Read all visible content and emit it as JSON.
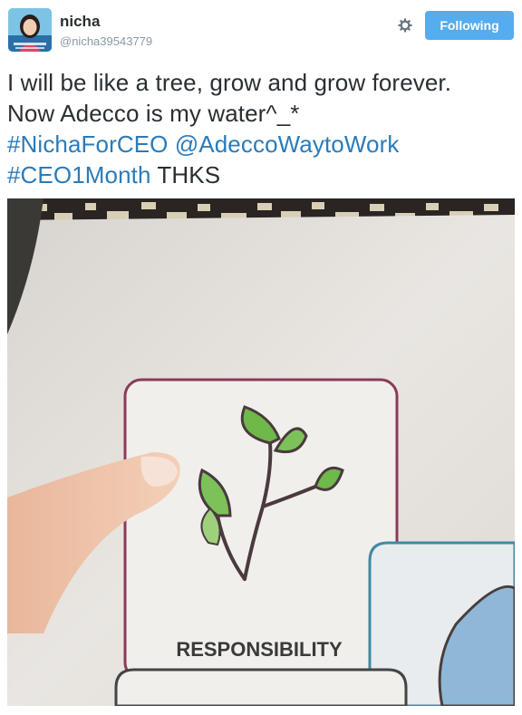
{
  "user": {
    "display_name": "nicha",
    "handle": "@nicha39543779"
  },
  "actions": {
    "follow_label": "Following"
  },
  "tweet": {
    "line1": "I will be like a tree, grow and grow forever.",
    "line2": "Now Adecco is my water^_*",
    "hashtag1": "#NichaForCEO",
    "mention1": "@AdeccoWaytoWork",
    "hashtag2": "#CEO1Month",
    "trailing": "THKS"
  },
  "photo": {
    "card_label": "RESPONSIBILITY"
  },
  "icons": {
    "settings": "gear-icon"
  },
  "colors": {
    "follow_button": "#55acee",
    "link": "#2b7bb9",
    "text": "#292f33",
    "handle": "#8899a6"
  }
}
